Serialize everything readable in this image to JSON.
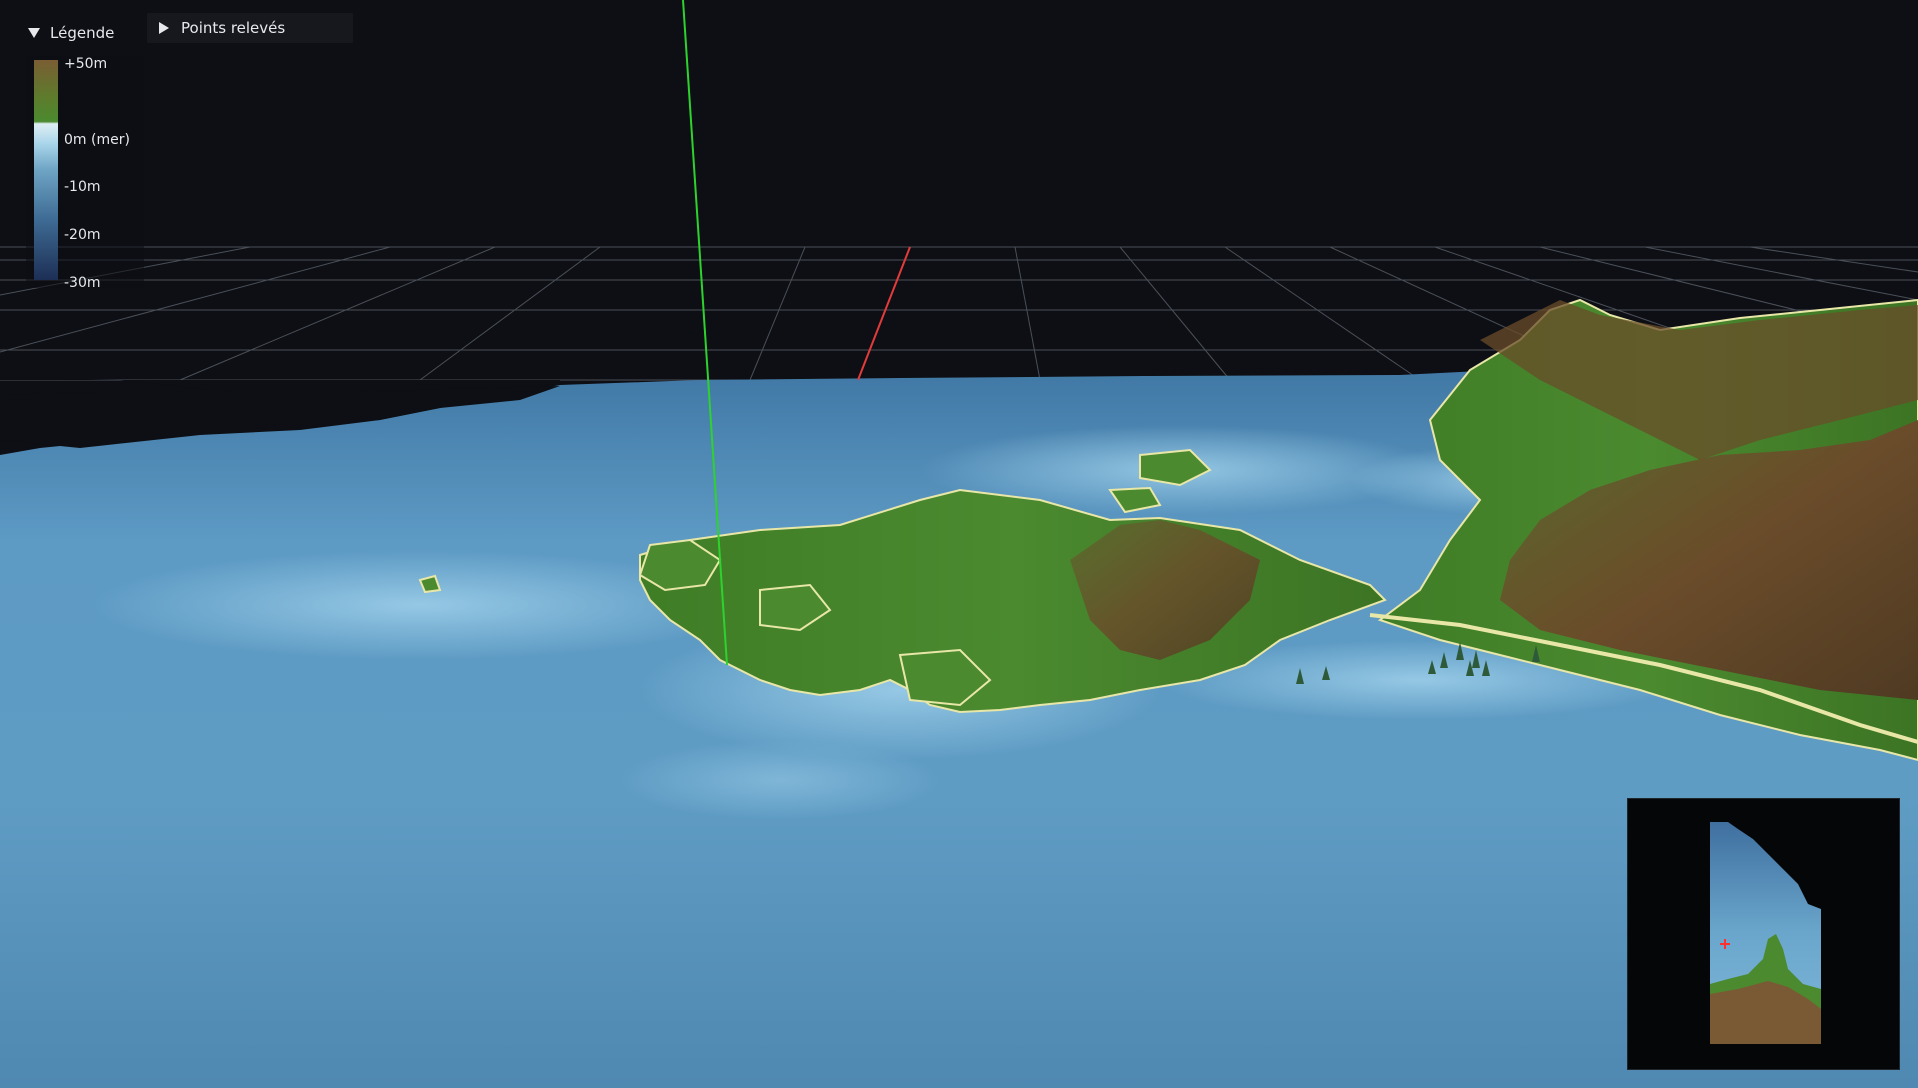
{
  "legend": {
    "toggle_label": "Légende",
    "labels": [
      "+50m",
      "0m (mer)",
      "-10m",
      "-20m",
      "-30m"
    ],
    "colors": {
      "high_land": "#7a5d34",
      "low_land": "#4b8a2f",
      "shallow": "#dfeef4",
      "mid_depth": "#6ea4c4",
      "deep": "#1d2f55"
    }
  },
  "points_panel": {
    "toggle_label": "Points relevés"
  },
  "scene": {
    "axis_colors": {
      "y_axis": "#2ed22e",
      "x_axis": "#e23b3b",
      "grid": "#5a5f6a"
    },
    "background": "#0d0f14"
  },
  "minimap": {
    "marker_icon": "plus-icon",
    "marker_color": "#ff3030"
  }
}
